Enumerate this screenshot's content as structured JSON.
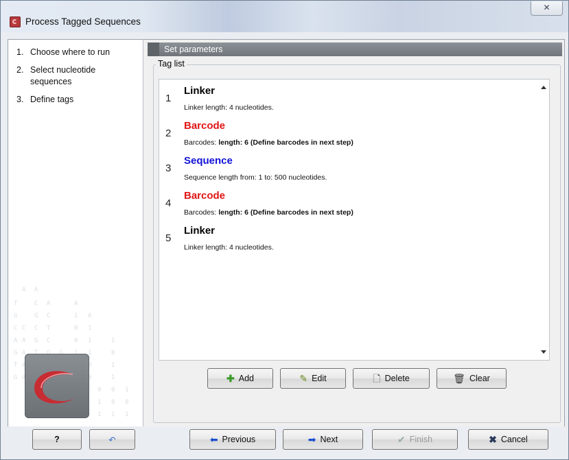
{
  "window": {
    "title": "Process Tagged Sequences",
    "close_glyph": "✕"
  },
  "steps": [
    {
      "num": "1.",
      "label": "Choose where to run"
    },
    {
      "num": "2.",
      "label": "Select nucleotide sequences"
    },
    {
      "num": "3.",
      "label": "Define tags"
    }
  ],
  "panel": {
    "header": "Set parameters",
    "group_title": "Tag list"
  },
  "tags": [
    {
      "num": "1",
      "name": "Linker",
      "color": "#000000",
      "desc_plain": "Linker length: 4 nucleotides.",
      "desc_bold": ""
    },
    {
      "num": "2",
      "name": "Barcode",
      "color": "#e01414",
      "desc_plain": "Barcodes: ",
      "desc_bold": "length: 6 (Define barcodes in next step)"
    },
    {
      "num": "3",
      "name": "Sequence",
      "color": "#1212d6",
      "desc_plain": "Sequence length from: 1 to: 500 nucleotides.",
      "desc_bold": ""
    },
    {
      "num": "4",
      "name": "Barcode",
      "color": "#e01414",
      "desc_plain": "Barcodes: ",
      "desc_bold": "length: 6 (Define barcodes in next step)"
    },
    {
      "num": "5",
      "name": "Linker",
      "color": "#000000",
      "desc_plain": "Linker length: 4 nucleotides.",
      "desc_bold": ""
    }
  ],
  "list_buttons": {
    "add": "Add",
    "edit": "Edit",
    "delete": "Delete",
    "clear": "Clear"
  },
  "nav_buttons": {
    "help": "?",
    "previous": "Previous",
    "next": "Next",
    "finish": "Finish",
    "cancel": "Cancel"
  },
  "icons": {
    "help": "help-icon",
    "reset": "reset-arrow-icon",
    "add": "plus-icon",
    "edit": "pencil-icon",
    "delete": "delete-document-icon",
    "clear": "trash-icon",
    "previous": "arrow-left-icon",
    "next": "arrow-right-icon",
    "finish": "checkmark-icon",
    "cancel": "x-icon"
  }
}
